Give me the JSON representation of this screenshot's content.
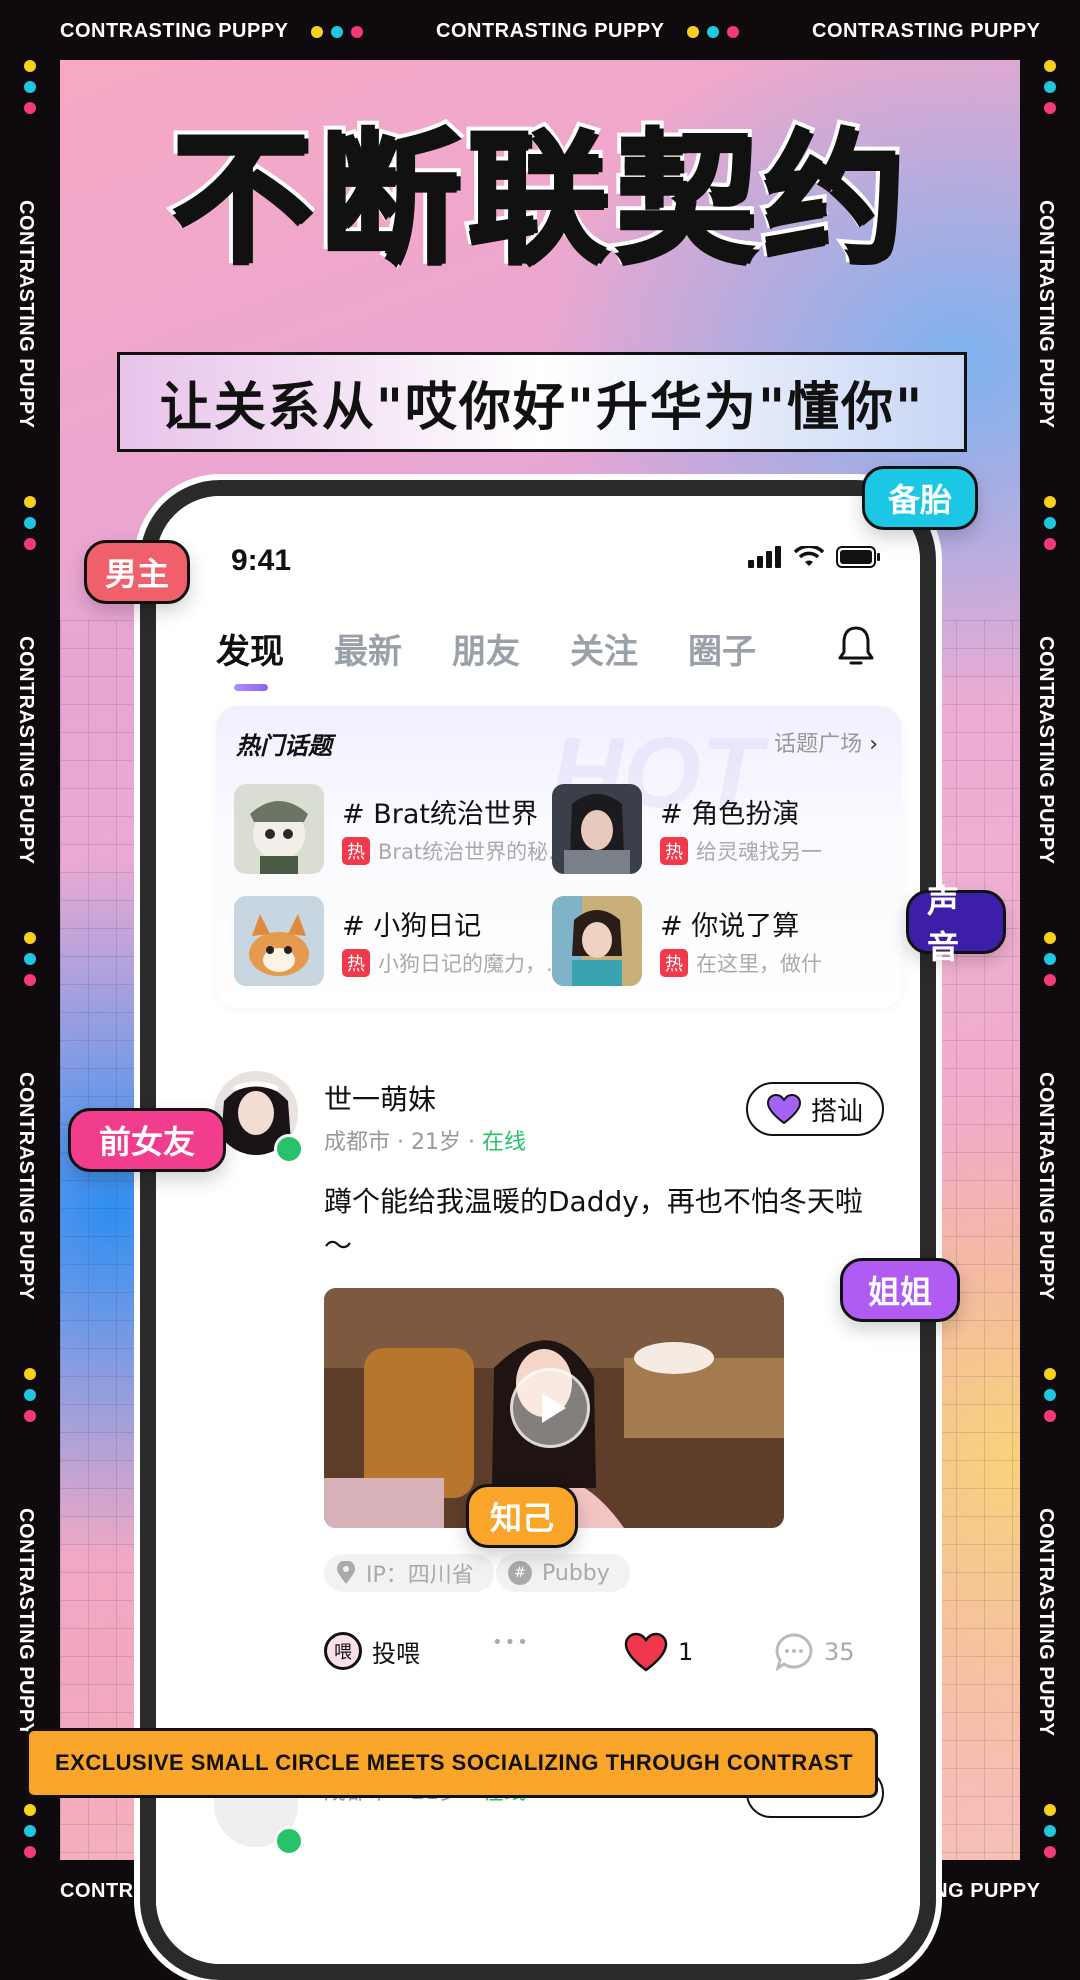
{
  "frame": {
    "repeat_text": "CONTRASTING PUPPY",
    "dot_colors": [
      "#f6d21c",
      "#1fc8e0",
      "#f43a7a"
    ]
  },
  "headline": "不断联契约",
  "subtitle": "让关系从\"哎你好\"升华为\"懂你\"",
  "status_bar": {
    "time": "9:41"
  },
  "tabs": [
    {
      "label": "发现",
      "active": true
    },
    {
      "label": "最新",
      "active": false
    },
    {
      "label": "朋友",
      "active": false
    },
    {
      "label": "关注",
      "active": false
    },
    {
      "label": "圈子",
      "active": false
    }
  ],
  "hot_topics": {
    "title": "热门话题",
    "more_label": "话题广场",
    "watermark": "HOT",
    "hot_badge": "热",
    "items": [
      {
        "name": "# Brat统治世界",
        "desc": "Brat统治世界的秘..."
      },
      {
        "name": "# 角色扮演",
        "desc": "给灵魂找另一"
      },
      {
        "name": "# 小狗日记",
        "desc": "小狗日记的魔力，..."
      },
      {
        "name": "# 你说了算",
        "desc": "在这里，做什"
      }
    ]
  },
  "post": {
    "username": "世一萌妹",
    "city": "成都市",
    "age": "21岁",
    "status": "在线",
    "chat_button": "搭讪",
    "text": "蹲个能给我温暖的Daddy，再也不怕冬天啦～",
    "tags": [
      "IP：四川省",
      "Pubby"
    ],
    "actions": {
      "feed_icon_text": "喂",
      "feed_label": "投喂",
      "more": "•••",
      "likes": "1",
      "comments": "35"
    }
  },
  "post2": {
    "city": "成都市",
    "age": "21岁",
    "status": "在线"
  },
  "stickers": {
    "male_lead": "男主",
    "backup": "备胎",
    "voice": "声音",
    "ex_girlfriend": "前女友",
    "sister": "姐姐",
    "soulmate": "知己"
  },
  "banner": "EXCLUSIVE SMALL CIRCLE MEETS SOCIALIZING THROUGH CONTRAST",
  "colors": {
    "sticker_red": "#f0606a",
    "sticker_cyan": "#1cc7e6",
    "sticker_indigo": "#3c1ea8",
    "sticker_magenta": "#f23d8e",
    "sticker_purple": "#b05cf2",
    "sticker_orange": "#f9a52a",
    "online_green": "#27c26a",
    "hot_red": "#f03a4c"
  }
}
